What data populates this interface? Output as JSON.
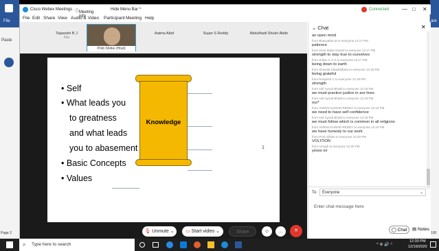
{
  "word": {
    "file_label": "File",
    "paste_label": "Paste",
    "page_label": "Page 2",
    "right_label": "are",
    "right_bottom": "100"
  },
  "webex": {
    "app_title": "Cisco Webex Meetings",
    "meeting_info": "Meeting Info",
    "hide_menu_bar": "Hide Menu Bar ^",
    "connected": "Connected",
    "connected_color": "#2e9e44",
    "menu": [
      "File",
      "Edit",
      "Share",
      "View",
      "Audio & Video",
      "Participant",
      "Meeting",
      "Help"
    ]
  },
  "participants": [
    {
      "name": "Tejaswini B J",
      "sub": "File"
    },
    {
      "name": "Prob Shirke (Host)",
      "sub": ""
    },
    {
      "name": "Aatma Altaf",
      "sub": ""
    },
    {
      "name": "Sujan S Reddy",
      "sub": ""
    },
    {
      "name": "Abdulhadi Shukri Abdn",
      "sub": ""
    }
  ],
  "slide": {
    "bullets": [
      "Self",
      "What leads you",
      "to greatness",
      "and what leads",
      "you to abasement",
      "Basic Concepts",
      "Values"
    ],
    "scroll_label": "Knowledge",
    "page_marker": "1",
    "scroll_color": "#f5b800"
  },
  "controls": {
    "unmute": "Unmute",
    "start_video": "Start video",
    "share": "Share",
    "chat": "Chat",
    "notes": "Notes",
    "end_color": "#e0362c"
  },
  "chat": {
    "header": "Chat",
    "messages": [
      {
        "meta": "",
        "text": "an open mind"
      },
      {
        "meta": "from Bhavyatha M to everyone   12:17 PM",
        "text": "patience"
      },
      {
        "meta": "from Irene Marie Daniel to everyone   12:17 PM",
        "text": "strength to stay true to ourselves"
      },
      {
        "meta": "from Srikar G S S to everyone   12:17 PM",
        "text": "being down to earth"
      },
      {
        "meta": "from Shiveda Shashidhara to everyone   12:18 PM",
        "text": "being grateful"
      },
      {
        "meta": "from Roopesh C to everyone   12:18 PM",
        "text": "strength"
      },
      {
        "meta": "from Asif Ayoub Bhatti to everyone   12:18 PM",
        "text": "we must practice justice in aor lives"
      },
      {
        "meta": "from Asif Ayoub Bhatti to everyone   12:18 PM",
        "text": "our*"
      },
      {
        "meta": "from VARUN KUMAR REDDY to everyone   12:18 PM",
        "text": "we need to have self confidence"
      },
      {
        "meta": "from Asif Ayoub Bhatti to everyone   12:18 PM",
        "text": "we must follow which is common in all religions"
      },
      {
        "meta": "from VARUN KUMAR REDDY to everyone   12:19 PM",
        "text": "we have honesty to our work"
      },
      {
        "meta": "from Prob Shirke to everyone   12:20 PM",
        "text": "VOLITION"
      },
      {
        "meta": "from Amogh to everyone   12:20 PM",
        "text": "yesss sir"
      }
    ],
    "to_label": "To:",
    "to_value": "Everyone",
    "input_placeholder": "Enter chat message here"
  },
  "taskbar": {
    "search_placeholder": "Type here to search",
    "time": "12:30 PM",
    "date": "12/16/2020"
  }
}
